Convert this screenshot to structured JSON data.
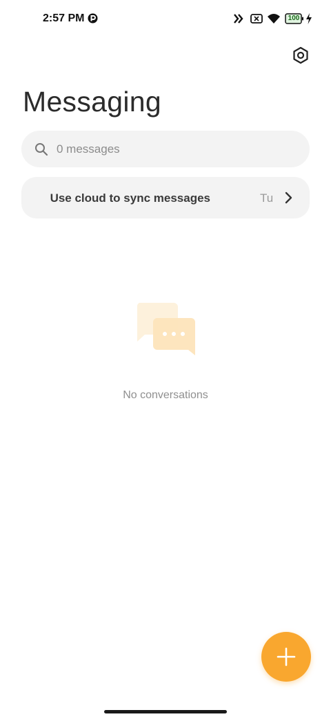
{
  "status_bar": {
    "time": "2:57 PM",
    "battery_level": "100",
    "icons": [
      "p-icon",
      "data-saver-icon",
      "no-sim-icon",
      "wifi-icon",
      "battery-icon",
      "charging-bolt-icon"
    ]
  },
  "header": {
    "title": "Messaging",
    "settings_icon": "settings-icon"
  },
  "search": {
    "placeholder": "0 messages",
    "icon": "search-icon"
  },
  "sync_banner": {
    "text": "Use cloud to sync messages",
    "action": "Turn on",
    "chevron": "chevron-right-icon"
  },
  "empty_state": {
    "icon": "chat-bubbles-icon",
    "text": "No conversations"
  },
  "fab": {
    "icon": "plus-icon"
  },
  "colors": {
    "accent": "#f9a72f",
    "surface": "#f3f3f3",
    "text_primary": "#2b2b2b",
    "text_secondary": "#8f8f8f"
  }
}
